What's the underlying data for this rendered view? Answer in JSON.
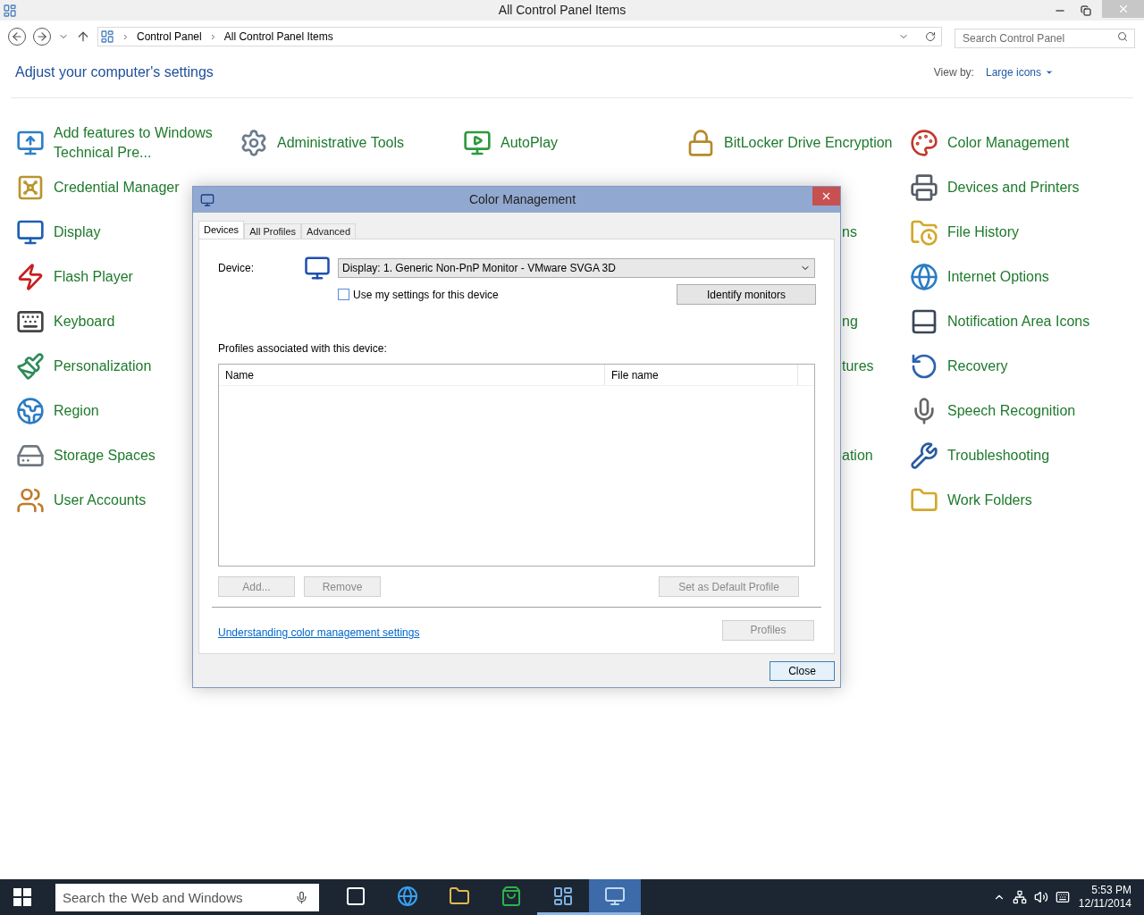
{
  "window": {
    "title": "All Control Panel Items"
  },
  "nav": {
    "breadcrumb": [
      "Control Panel",
      "All Control Panel Items"
    ],
    "search": {
      "placeholder": "Search Control Panel"
    }
  },
  "header": {
    "title": "Adjust your computer's settings",
    "view_by_label": "View by:",
    "view_by_value": "Large icons"
  },
  "rows": [
    {
      "cells": [
        {
          "kind": "item",
          "label": "Add features to Windows Technical Pre..."
        },
        {
          "kind": "item",
          "label": "Administrative Tools"
        },
        {
          "kind": "item",
          "label": "AutoPlay"
        },
        {
          "kind": "item",
          "label": "BitLocker Drive Encryption"
        },
        {
          "kind": "item",
          "label": "Color Management"
        }
      ]
    },
    {
      "cells": [
        {
          "kind": "item",
          "label": "Credential Manager"
        },
        {
          "kind": "covered"
        },
        {
          "kind": "covered"
        },
        {
          "kind": "covered"
        },
        {
          "kind": "item",
          "label": "Devices and Printers"
        }
      ]
    },
    {
      "cells": [
        {
          "kind": "item",
          "label": "Display"
        },
        {
          "kind": "covered"
        },
        {
          "kind": "covered"
        },
        {
          "kind": "fragment",
          "text": "ns"
        },
        {
          "kind": "item",
          "label": "File History"
        }
      ]
    },
    {
      "cells": [
        {
          "kind": "item",
          "label": "Flash Player"
        },
        {
          "kind": "covered"
        },
        {
          "kind": "covered"
        },
        {
          "kind": "covered"
        },
        {
          "kind": "item",
          "label": "Internet Options"
        }
      ]
    },
    {
      "cells": [
        {
          "kind": "item",
          "label": "Keyboard"
        },
        {
          "kind": "covered"
        },
        {
          "kind": "covered"
        },
        {
          "kind": "fragment",
          "text": "ng"
        },
        {
          "kind": "item",
          "label": "Notification Area Icons"
        }
      ]
    },
    {
      "cells": [
        {
          "kind": "item",
          "label": "Personalization"
        },
        {
          "kind": "covered"
        },
        {
          "kind": "covered"
        },
        {
          "kind": "fragment",
          "text": "tures"
        },
        {
          "kind": "item",
          "label": "Recovery"
        }
      ]
    },
    {
      "cells": [
        {
          "kind": "item",
          "label": "Region"
        },
        {
          "kind": "covered"
        },
        {
          "kind": "covered"
        },
        {
          "kind": "covered"
        },
        {
          "kind": "item",
          "label": "Speech Recognition"
        }
      ]
    },
    {
      "cells": [
        {
          "kind": "item",
          "label": "Storage Spaces"
        },
        {
          "kind": "covered"
        },
        {
          "kind": "covered"
        },
        {
          "kind": "fragment",
          "text": "ation"
        },
        {
          "kind": "item",
          "label": "Troubleshooting"
        }
      ]
    },
    {
      "cells": [
        {
          "kind": "item",
          "label": "User Accounts"
        },
        {
          "kind": "covered"
        },
        {
          "kind": "covered"
        },
        {
          "kind": "covered"
        },
        {
          "kind": "item",
          "label": "Work Folders"
        }
      ]
    }
  ],
  "dialog": {
    "title": "Color Management",
    "tabs": [
      {
        "label": "Devices",
        "selected": true
      },
      {
        "label": "All Profiles",
        "selected": false
      },
      {
        "label": "Advanced",
        "selected": false
      }
    ],
    "device_label": "Device:",
    "device_value": "Display: 1. Generic Non-PnP Monitor - VMware SVGA 3D",
    "use_my_settings": {
      "label": "Use my settings for this device",
      "checked": false
    },
    "identify_button": "Identify monitors",
    "profiles_label": "Profiles associated with this device:",
    "table_columns": [
      "Name",
      "File name"
    ],
    "left_buttons": [
      {
        "label": "Add...",
        "disabled": true
      },
      {
        "label": "Remove",
        "disabled": true
      }
    ],
    "default_button": {
      "label": "Set as Default Profile",
      "disabled": true
    },
    "link": "Understanding color management settings",
    "profiles_button": {
      "label": "Profiles",
      "disabled": true
    },
    "close_button": "Close"
  },
  "taskbar": {
    "search_placeholder": "Search the Web and Windows",
    "apps": [
      {
        "selected": false,
        "running": false
      },
      {
        "selected": false,
        "running": false
      },
      {
        "selected": false,
        "running": false
      },
      {
        "selected": false,
        "running": false
      },
      {
        "selected": false,
        "running": true
      },
      {
        "selected": true,
        "running": true
      }
    ],
    "time": "5:53 PM",
    "date": "12/11/2014"
  }
}
